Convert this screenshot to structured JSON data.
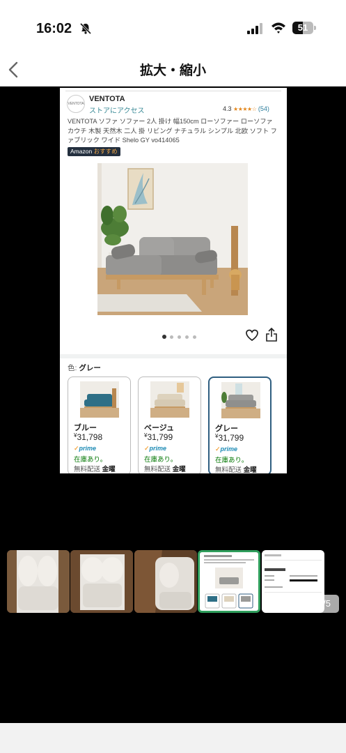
{
  "status_bar": {
    "time": "16:02",
    "battery_level": "51",
    "battery_fraction": 0.51,
    "icons": [
      "bell-slash-icon",
      "signal-icon",
      "wifi-icon",
      "battery-icon"
    ]
  },
  "nav": {
    "title": "拡大・縮小",
    "back_icon": "chevron-left-icon"
  },
  "screenshot": {
    "brand_logo_text": "VENTOTA",
    "brand_name": "VENTOTA",
    "store_link": "ストアにアクセス",
    "rating_value": "4.3",
    "rating_stars": "★★★★☆",
    "rating_count": "(54)",
    "product_title": "VENTOTA ソファ ソファー 2人 掛け 幅150cm ローソファー ローソファ カウチ 木製 天然木 二人 掛 リビング ナチュラル シンプル 北欧 ソフト ファブリック ワイド Shelo GY vo414065",
    "badge_amazon": "Amazon",
    "badge_recommend": "おすすめ",
    "image_dots": 5,
    "active_dot": 0,
    "color_label": "色:",
    "color_value": "グレー",
    "swatches": [
      {
        "name": "ブルー",
        "currency": "¥",
        "price": "31,798",
        "prime": "prime",
        "stock": "在庫あり。",
        "shipping": "無料配送",
        "day": "金曜",
        "sofa_color": "#2e6f86"
      },
      {
        "name": "ベージュ",
        "currency": "¥",
        "price": "31,799",
        "prime": "prime",
        "stock": "在庫あり。",
        "shipping": "無料配送",
        "day": "金曜",
        "sofa_color": "#ddd2bd"
      },
      {
        "name": "グレー",
        "currency": "¥",
        "price": "31,799",
        "prime": "prime",
        "stock": "在庫あり。",
        "shipping": "無料配送",
        "day": "金曜",
        "sofa_color": "#9a9a98"
      }
    ]
  },
  "viewer": {
    "page_indicator": "4/5",
    "current_index": 3,
    "thumbnails": [
      "photo-1",
      "photo-2",
      "photo-3",
      "screenshot-product",
      "screenshot-order"
    ]
  },
  "colors": {
    "accent_green": "#2f9e5c",
    "viewer_background": "#000000",
    "link_teal": "#3a8a96"
  }
}
